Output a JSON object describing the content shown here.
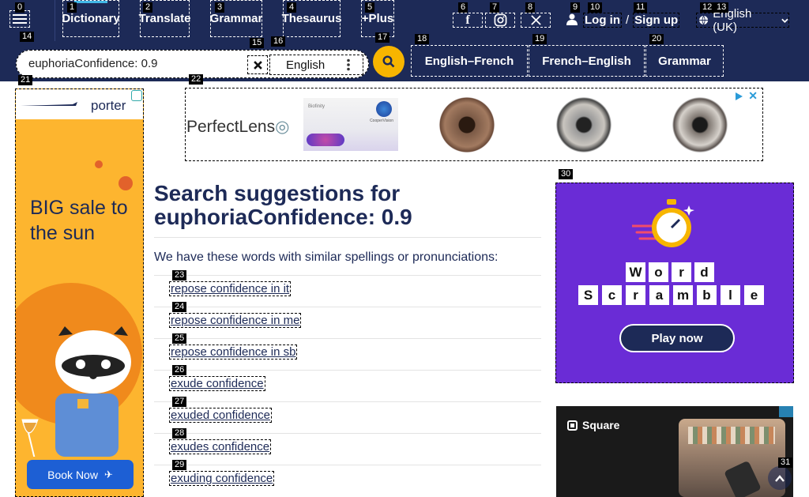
{
  "nav": {
    "items": [
      {
        "label": "Dictionary",
        "tag": "1"
      },
      {
        "label": "Translate",
        "tag": "2"
      },
      {
        "label": "Grammar",
        "tag": "3"
      },
      {
        "label": "Thesaurus",
        "tag": "4"
      },
      {
        "label": "+Plus",
        "tag": "5"
      }
    ],
    "menu_tag": "0",
    "social_tags": [
      "6",
      "7",
      "8"
    ],
    "login_icon_tag": "9",
    "login_tag": "10",
    "signup_tag": "11",
    "login_label": "Log in",
    "slash": "/",
    "signup_label": "Sign up",
    "lang_tags": [
      "12",
      "13"
    ],
    "lang_label": "English (UK)"
  },
  "search": {
    "tag": "14",
    "value": "euphoriaConfidence: 0.9",
    "clear_tag": "15",
    "lang_tag": "16",
    "lang_value": "English",
    "go_tag": "17"
  },
  "quicklinks": [
    {
      "label": "English–French",
      "tag": "18"
    },
    {
      "label": "French–English",
      "tag": "19"
    },
    {
      "label": "Grammar",
      "tag": "20"
    }
  ],
  "ads": {
    "left": {
      "tag": "21",
      "brand": "porter",
      "headline": "BIG sale to the sun",
      "cta": "Book Now"
    },
    "top": {
      "tag": "22",
      "brand": "PerfectLens",
      "box_text_1": "Biofinity",
      "box_text_2": "CooperVision"
    },
    "right": {
      "tag": "30",
      "word1": [
        "W",
        "o",
        "r",
        "d"
      ],
      "word2": [
        "S",
        "c",
        "r",
        "a",
        "m",
        "b",
        "l",
        "e"
      ],
      "cta": "Play now"
    },
    "square": {
      "brand": "Square"
    }
  },
  "main": {
    "heading": "Search suggestions for",
    "query": "euphoriaConfidence: 0.9",
    "intro": "We have these words with similar spellings or pronunciations:",
    "suggestions": [
      {
        "label": "repose confidence in it",
        "tag": "23"
      },
      {
        "label": "repose confidence in me",
        "tag": "24"
      },
      {
        "label": "repose confidence in sb",
        "tag": "25"
      },
      {
        "label": "exude confidence",
        "tag": "26"
      },
      {
        "label": "exuded confidence",
        "tag": "27"
      },
      {
        "label": "exudes confidence",
        "tag": "28"
      },
      {
        "label": "exuding confidence",
        "tag": "29"
      }
    ]
  },
  "backtop_tag": "31",
  "colors": {
    "navy": "#1d2a57",
    "accent": "#f7b500",
    "light_blue": "#42b8e7"
  }
}
